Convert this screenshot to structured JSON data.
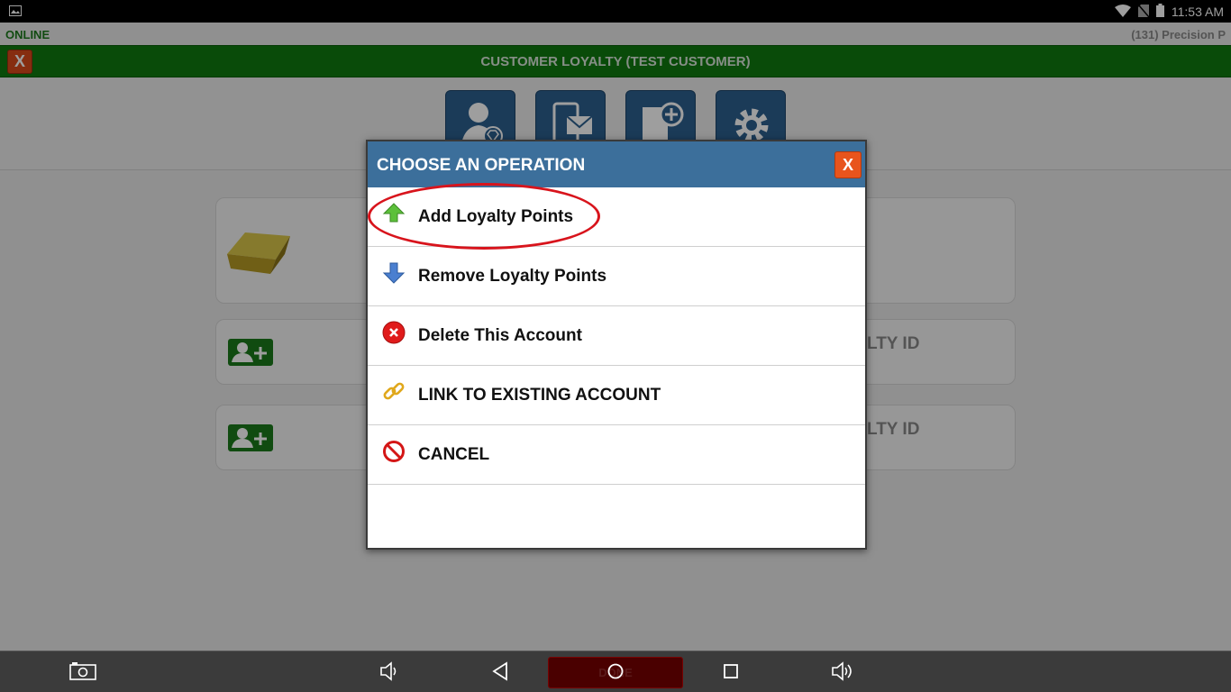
{
  "statusbar": {
    "time": "11:53 AM"
  },
  "infobar": {
    "status": "ONLINE",
    "store": "(131) Precision P"
  },
  "titlebar": {
    "title": "CUSTOMER LOYALTY (TEST CUSTOMER)",
    "close_label": "X"
  },
  "background_cards": {
    "card2_ghost": "LTY ID",
    "card3_ghost": "LTY ID"
  },
  "modal": {
    "title": "CHOOSE AN OPERATION",
    "close_label": "X",
    "operations": [
      {
        "label": "Add Loyalty Points",
        "icon": "arrow-up-green-icon"
      },
      {
        "label": "Remove Loyalty Points",
        "icon": "arrow-down-blue-icon"
      },
      {
        "label": "Delete This Account",
        "icon": "delete-red-icon"
      },
      {
        "label": "LINK TO EXISTING ACCOUNT",
        "icon": "chain-link-icon"
      },
      {
        "label": "CANCEL",
        "icon": "no-symbol-icon"
      }
    ]
  },
  "navbar": {
    "done_label": "DONE"
  },
  "colors": {
    "title_green": "#0f7a10",
    "modal_header_blue": "#3c6f9b",
    "close_orange": "#e8541c",
    "highlight_red": "#d8141c"
  }
}
